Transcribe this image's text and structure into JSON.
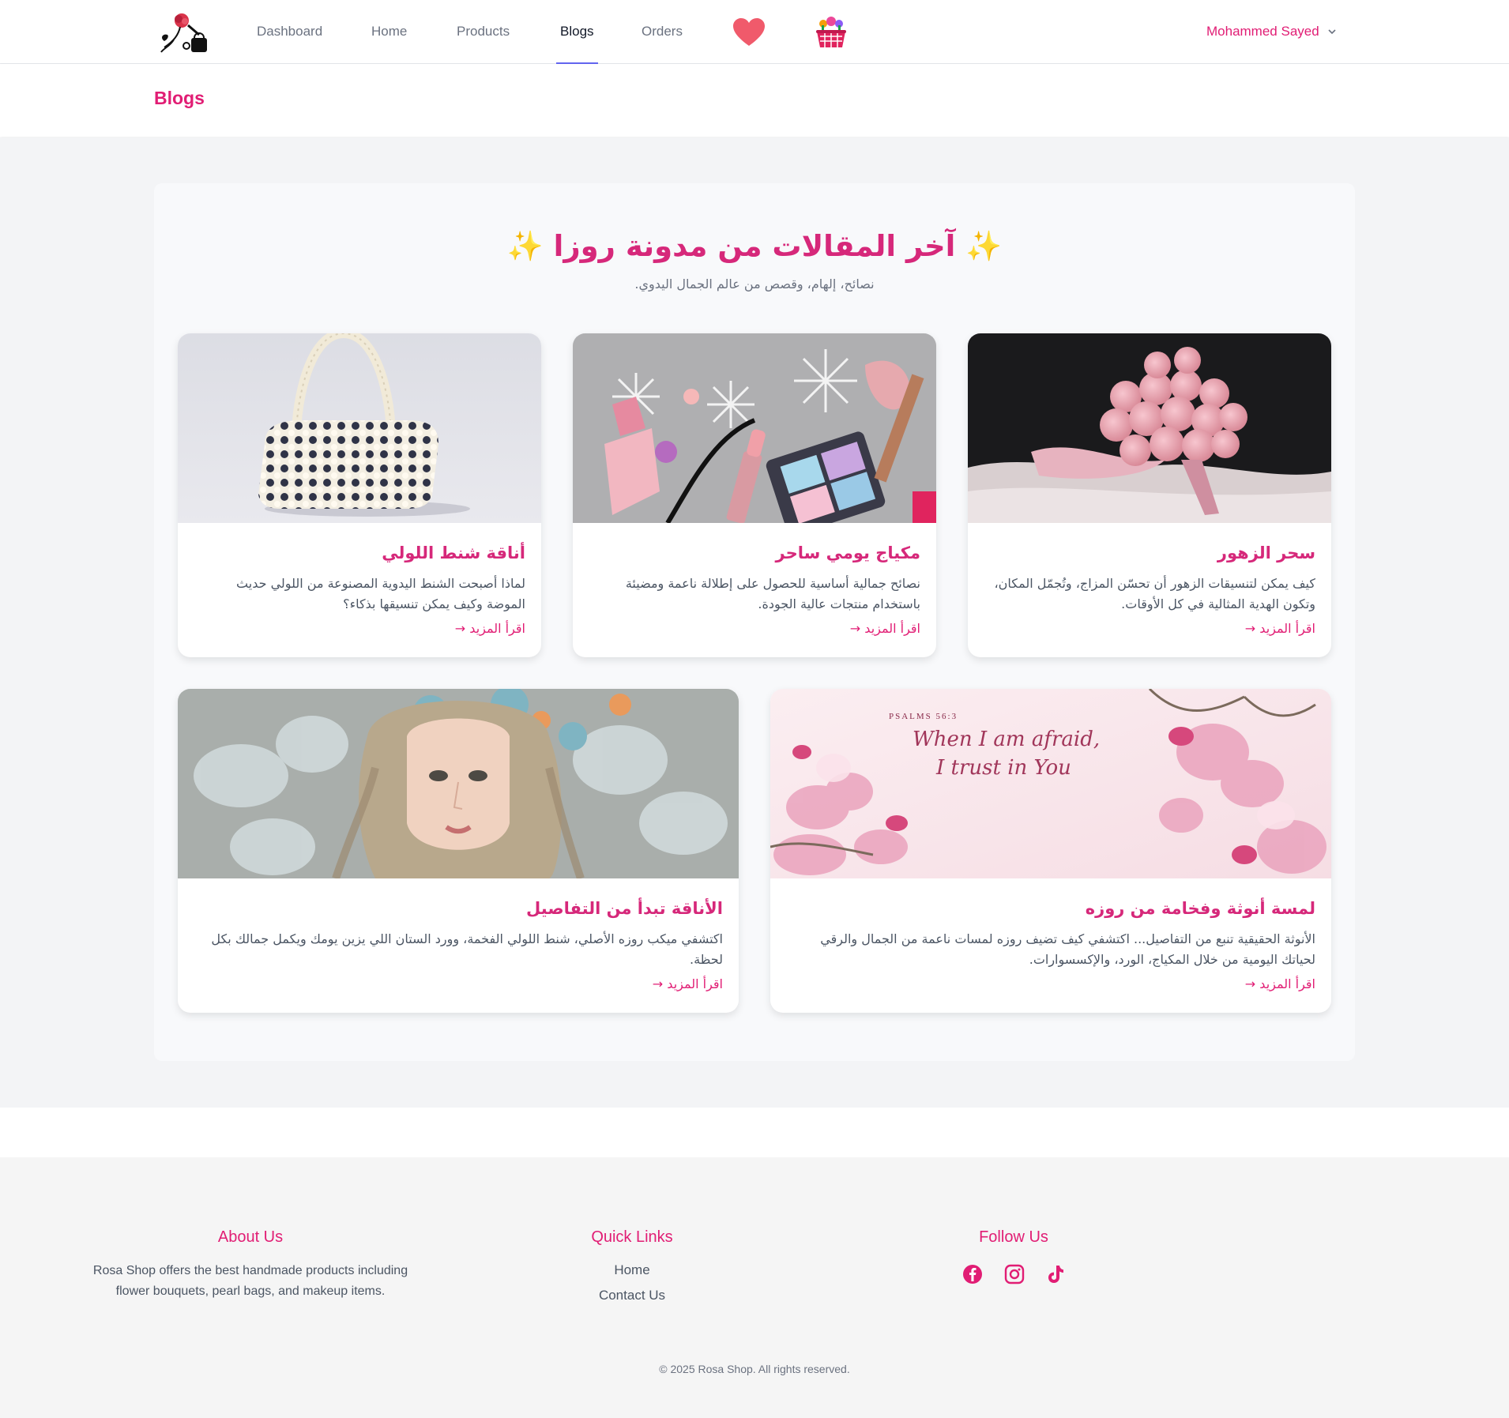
{
  "nav": {
    "logo_icon": "rosa-shop-logo",
    "links": [
      {
        "label": "Dashboard"
      },
      {
        "label": "Home"
      },
      {
        "label": "Products"
      },
      {
        "label": "Blogs",
        "active": true
      },
      {
        "label": "Orders"
      }
    ],
    "wishlist_icon": "heart-icon",
    "cart_icon": "basket-icon",
    "user_name": "Mohammed Sayed"
  },
  "page_header": {
    "title": "Blogs"
  },
  "blog_section": {
    "title": "✨ آخر المقالات من مدونة روزا ✨",
    "subtitle": "نصائح، إلهام، وقصص من عالم الجمال اليدوي.",
    "read_more": "اقرأ المزيد →",
    "posts": [
      {
        "title": "سحر الزهور",
        "description": "كيف يمكن لتنسيقات الزهور أن تحسّن المزاج، وتُجمّل المكان، وتكون الهدية المثالية في كل الأوقات.",
        "image": "pink-roses-bouquet"
      },
      {
        "title": "مكياج يومي ساحر",
        "description": "نصائح جمالية أساسية للحصول على إطلالة ناعمة ومضيئة باستخدام منتجات عالية الجودة.",
        "image": "makeup-products"
      },
      {
        "title": "أناقة شنط اللولي",
        "description": "لماذا أصبحت الشنط اليدوية المصنوعة من اللولي حديث الموضة وكيف يمكن تنسيقها بذكاء؟",
        "image": "pearl-handbag"
      },
      {
        "title": "لمسة أنوثة وفخامة من روزه",
        "description": "الأنوثة الحقيقية تنبع من التفاصيل... اكتشفي كيف تضيف روزه لمسات ناعمة من الجمال والرقي لحياتك اليومية من خلال المكياج، الورد، والإكسسوارات.",
        "image": "magnolia-psalm-banner",
        "image_text_small": "PSALMS 56:3",
        "image_text_line1": "When I am afraid,",
        "image_text_line2": "I trust in You"
      },
      {
        "title": "الأناقة تبدأ من التفاصيل",
        "description": "اكتشفي ميكب روزه الأصلي، شنط اللولي الفخمة، وورد الستان اللي يزين يومك ويكمل جمالك بكل لحظة.",
        "image": "woman-with-flowers"
      }
    ]
  },
  "footer": {
    "about": {
      "heading": "About Us",
      "line1": "Rosa Shop offers the best handmade products including",
      "line2": "flower bouquets, pearl bags, and makeup items."
    },
    "quick_links": {
      "heading": "Quick Links",
      "links": [
        "Home",
        "Contact Us"
      ]
    },
    "follow": {
      "heading": "Follow Us",
      "icons": [
        "facebook-icon",
        "instagram-icon",
        "tiktok-icon"
      ]
    },
    "copyright": "© 2025 Rosa Shop. All rights reserved."
  },
  "colors": {
    "brand": "#e11d74",
    "active_underline": "#6366f1",
    "page_bg": "#f3f4f6"
  }
}
